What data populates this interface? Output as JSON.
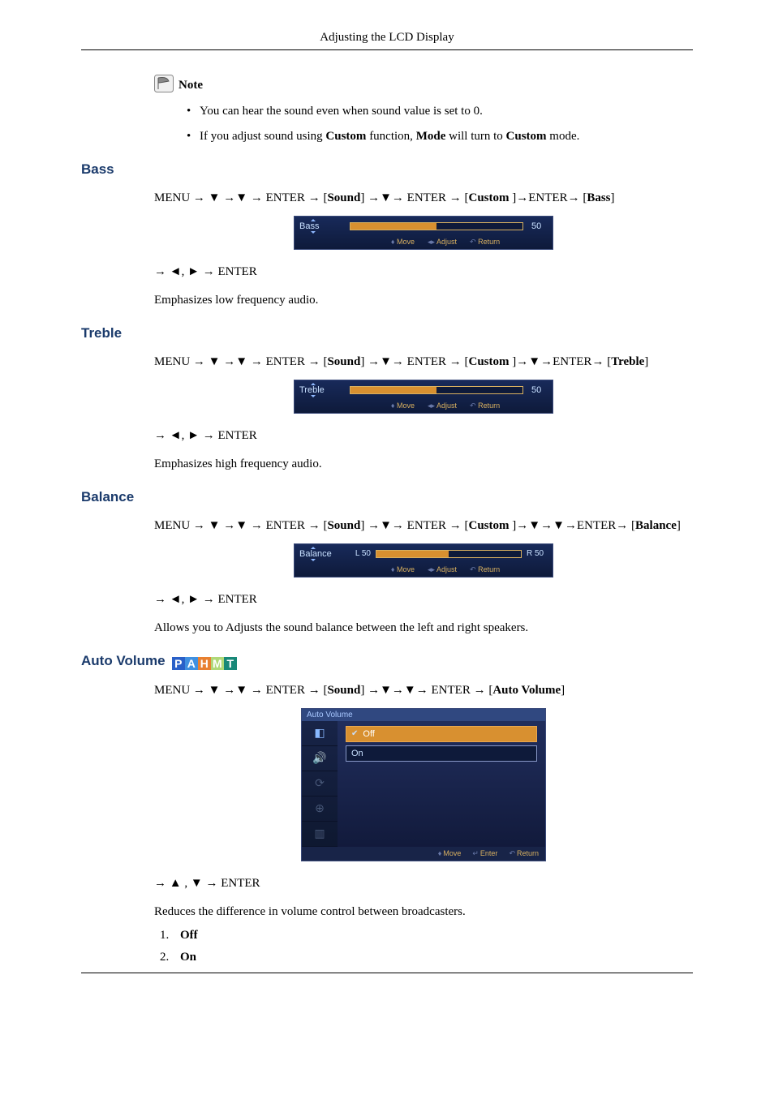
{
  "header": {
    "title": "Adjusting the LCD Display"
  },
  "note": {
    "label": "Note",
    "items": [
      "You can hear the sound even when sound value is set to 0.",
      "If you adjust sound using Custom function, Mode will turn to Custom mode."
    ]
  },
  "glyph": {
    "arrow_right": "→",
    "tri_down": "▼",
    "tri_up": "▲",
    "tri_left": "◄",
    "tri_right": "►",
    "comma": ", "
  },
  "nav": {
    "menu": "MENU",
    "enter": "ENTER",
    "sound": "Sound",
    "custom": "Custom "
  },
  "sections": {
    "bass": {
      "title": "Bass",
      "target": "Bass",
      "nav2": "→ ◄, ► → ENTER",
      "desc": "Emphasizes low frequency audio."
    },
    "treble": {
      "title": "Treble",
      "target": "Treble",
      "nav2": "→ ◄, ► → ENTER",
      "desc": "Emphasizes high frequency audio."
    },
    "balance": {
      "title": "Balance",
      "target": "Balance",
      "nav2": "→ ◄, ► → ENTER",
      "desc": "Allows you to Adjusts the sound balance between the left and right speakers."
    },
    "auto_volume": {
      "title": "Auto Volume",
      "target": "Auto Volume",
      "nav2": "→ ▲ , ▼ → ENTER",
      "desc": "Reduces the difference in volume control between broadcasters.",
      "options": {
        "1": "Off",
        "2": "On"
      }
    }
  },
  "osd": {
    "bass": {
      "label": "Bass",
      "value": "50"
    },
    "treble": {
      "label": "Treble",
      "value": "50"
    },
    "balance": {
      "label": "Balance",
      "left": "L 50",
      "right": "R 50"
    },
    "hints_slider": {
      "move": "Move",
      "adjust": "Adjust",
      "return": "Return"
    },
    "panel": {
      "title": "Auto Volume",
      "off": "Off",
      "on": "On",
      "hints": {
        "move": "Move",
        "enter": "Enter",
        "return": "Return"
      }
    }
  },
  "badge": {
    "p": "P",
    "a": "A",
    "h": "H",
    "m": "M",
    "t": "T"
  }
}
